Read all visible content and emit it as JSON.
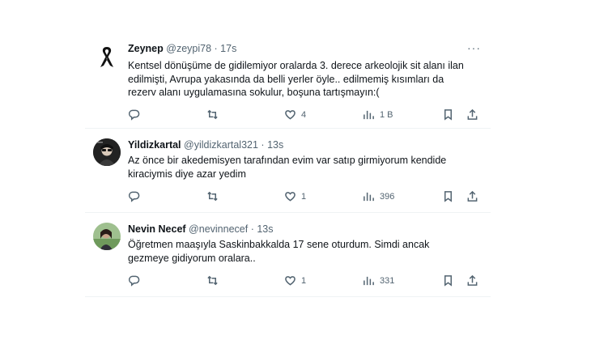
{
  "tweets": [
    {
      "name": "Zeynep",
      "handle": "@zeypi78",
      "dot": "·",
      "time": "17s",
      "lines": [
        "Kentsel dönüşüme de gidilemiyor oralarda 3. derece arkeolojik sit alanı ilan",
        "edilmişti, Avrupa yakasında da belli yerler öyle.. edilmemiş kısımları da",
        "rezerv alanı uygulamasına sokulur, boşuna tartışmayın:("
      ],
      "replies": "",
      "retweets": "",
      "likes": "4",
      "views": "1 B",
      "avatar_icon": "black-ribbon-icon"
    },
    {
      "name": "Yildizkartal",
      "handle": "@yildizkartal321",
      "dot": "·",
      "time": "13s",
      "lines": [
        "Az önce bir akedemisyen tarafından evim var satıp girmiyorum kendide",
        "kiraciymis diye azar yedim"
      ],
      "replies": "",
      "retweets": "",
      "likes": "1",
      "views": "396",
      "avatar_icon": "profile-photo"
    },
    {
      "name": "Nevin Necef",
      "handle": "@nevinnecef",
      "dot": "·",
      "time": "13s",
      "lines": [
        "Öğretmen maaşıyla Saskinbakkalda 17 sene oturdum. Simdi ancak",
        "gezmeye gidiyorum oralara.."
      ],
      "replies": "",
      "retweets": "",
      "likes": "1",
      "views": "331",
      "avatar_icon": "profile-photo"
    }
  ],
  "more_glyph": "···",
  "colors": {
    "text": "#0f1419",
    "secondary": "#536471",
    "divider": "#eff3f4"
  }
}
